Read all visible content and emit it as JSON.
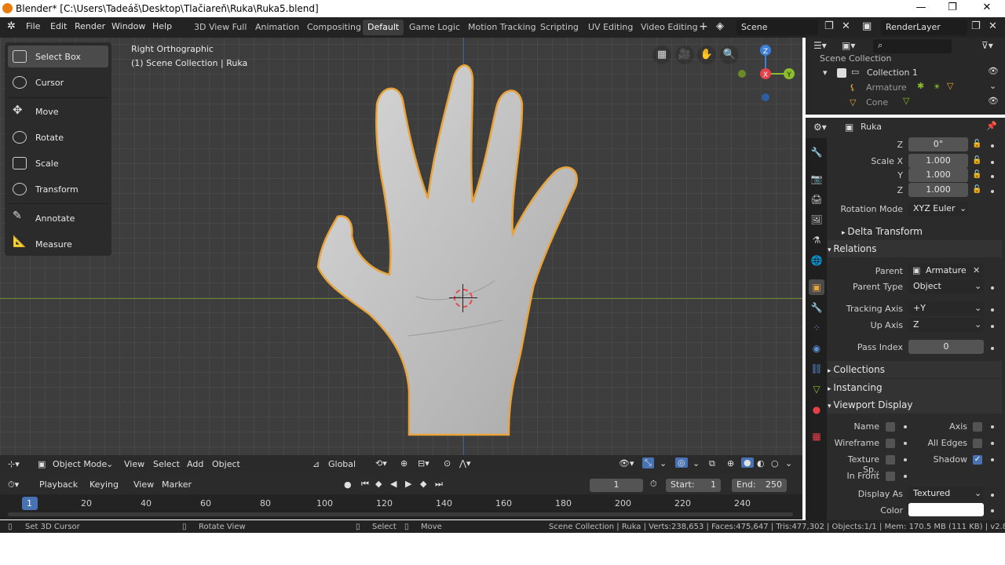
{
  "title": "Blender* [C:\\Users\\Tadeáš\\Desktop\\Tlačiareň\\Ruka\\Ruka5.blend]",
  "menu": [
    "File",
    "Edit",
    "Render",
    "Window",
    "Help"
  ],
  "workspaces": [
    "3D View Full",
    "Animation",
    "Compositing",
    "Default",
    "Game Logic",
    "Motion Tracking",
    "Scripting",
    "UV Editing",
    "Video Editing"
  ],
  "active_workspace": "Default",
  "scene": "Scene",
  "render_layer": "RenderLayer",
  "tools": [
    "Select Box",
    "Cursor",
    "Move",
    "Rotate",
    "Scale",
    "Transform",
    "Annotate",
    "Measure"
  ],
  "viewport": {
    "view_name": "Right Orthographic",
    "collection_line": "(1) Scene Collection | Ruka"
  },
  "gizmo": {
    "z": "Z",
    "x": "X",
    "y": "Y"
  },
  "vp_header": {
    "mode": "Object Mode",
    "menus": [
      "View",
      "Select",
      "Add",
      "Object"
    ],
    "orientation": "Global"
  },
  "timeline": {
    "menus": [
      "Playback",
      "Keying",
      "View",
      "Marker"
    ],
    "current_frame": "1",
    "start_label": "Start:",
    "start": "1",
    "end_label": "End:",
    "end": "250",
    "ticks": [
      "1",
      "20",
      "40",
      "60",
      "80",
      "100",
      "120",
      "140",
      "160",
      "180",
      "200",
      "220",
      "240"
    ]
  },
  "status": {
    "set_cursor": "Set 3D Cursor",
    "rotate_view": "Rotate View",
    "select": "Select",
    "move": "Move",
    "stats": "Scene Collection | Ruka | Verts:238,653 | Faces:475,647 | Tris:477,302 | Objects:1/1 | Mem: 170.5 MB (111 KB) | v2.80.75"
  },
  "outliner": {
    "root": "Scene Collection",
    "collection": "Collection 1",
    "items": [
      "Armature",
      "Cone"
    ]
  },
  "properties": {
    "object_name": "Ruka",
    "rot_z_label": "Z",
    "rot_z": "0°",
    "scale_x_label": "Scale X",
    "scale_x": "1.000",
    "scale_y_label": "Y",
    "scale_y": "1.000",
    "scale_z_label": "Z",
    "scale_z": "1.000",
    "rotation_mode_label": "Rotation Mode",
    "rotation_mode": "XYZ Euler",
    "delta_transform": "Delta Transform",
    "relations": "Relations",
    "parent_label": "Parent",
    "parent": "Armature",
    "parent_type_label": "Parent Type",
    "parent_type": "Object",
    "tracking_axis_label": "Tracking Axis",
    "tracking_axis": "+Y",
    "up_axis_label": "Up Axis",
    "up_axis": "Z",
    "pass_index_label": "Pass Index",
    "pass_index": "0",
    "collections": "Collections",
    "instancing": "Instancing",
    "viewport_display": "Viewport Display",
    "name_label": "Name",
    "axis_label": "Axis",
    "wireframe_label": "Wireframe",
    "all_edges_label": "All Edges",
    "texture_space_label": "Texture Sp..",
    "shadow_label": "Shadow",
    "in_front_label": "In Front",
    "display_as_label": "Display As",
    "display_as": "Textured",
    "color_label": "Color"
  },
  "colors": {
    "selection_outline": "#e8a33a",
    "accent": "#4772b3",
    "axis_x": "#e6404a",
    "axis_y": "#8cbd2b",
    "axis_z": "#3d7fd9"
  }
}
